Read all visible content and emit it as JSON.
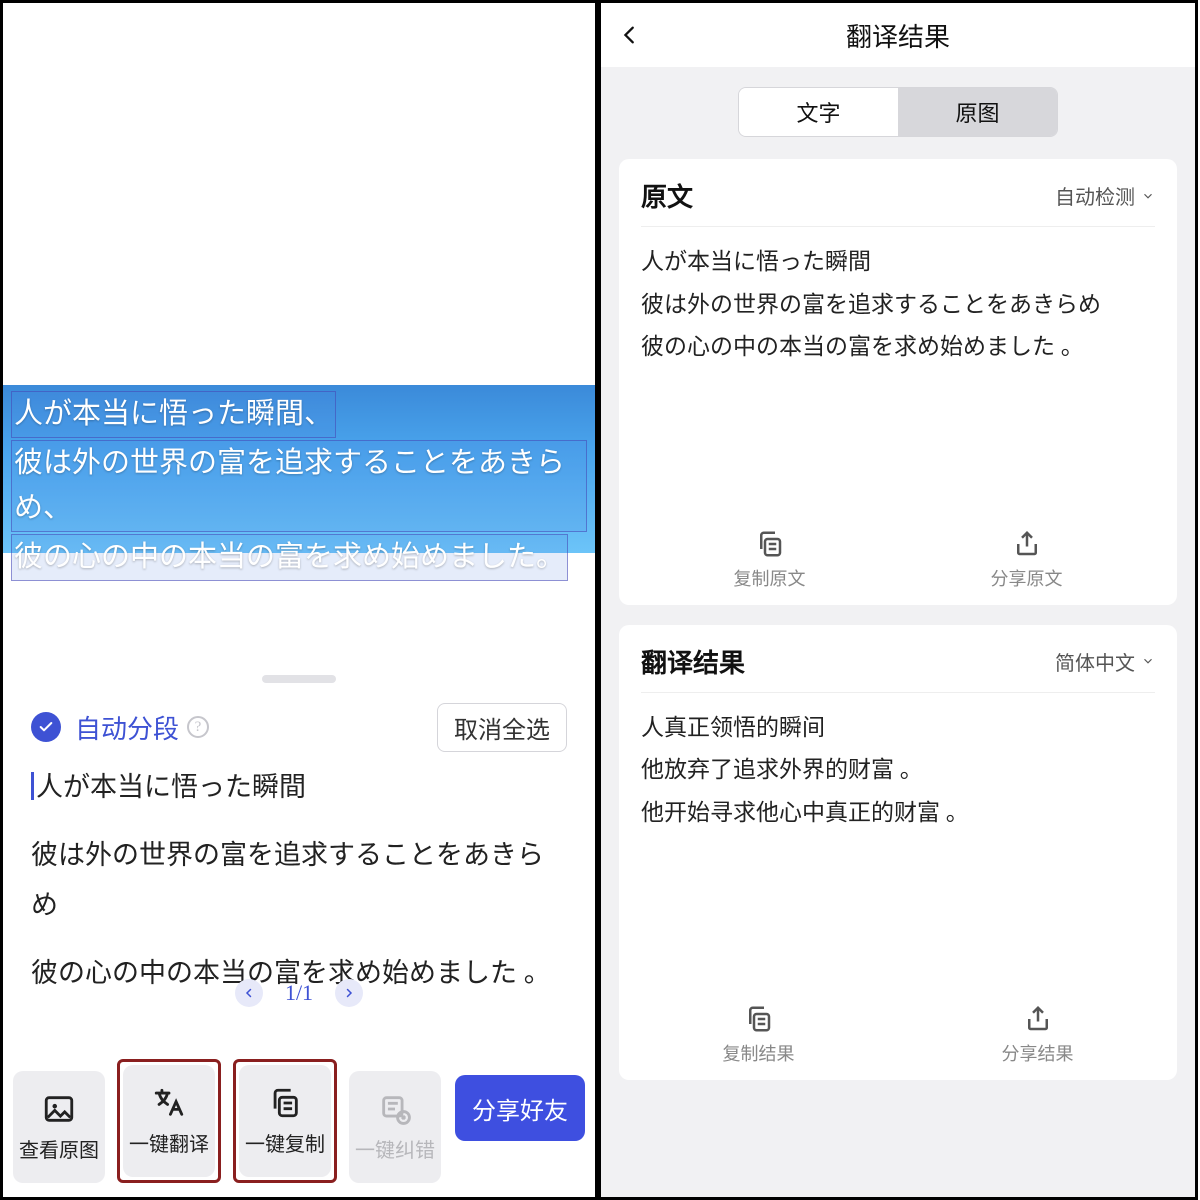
{
  "left": {
    "ocr_lines": [
      "人が本当に悟った瞬間、",
      "彼は外の世界の富を追求することをあきらめ、",
      "彼の心の中の本当の富を求め始めました。"
    ],
    "auto_segment_label": "自动分段",
    "deselect_all": "取消全选",
    "detected_lines": [
      "人が本当に悟った瞬間",
      "彼は外の世界の富を追求することをあきらめ",
      "彼の心の中の本当の富を求め始めました 。"
    ],
    "pager_text": "1/1",
    "toolbar": {
      "view_original": "查看原图",
      "translate": "一键翻译",
      "copy": "一键复制",
      "undo": "一键纠错",
      "share": "分享好友"
    }
  },
  "right": {
    "title": "翻译结果",
    "tab_text": "文字",
    "tab_image": "原图",
    "source": {
      "heading": "原文",
      "lang": "自动检测",
      "lines": [
        "人が本当に悟った瞬間",
        "彼は外の世界の富を追求することをあきらめ",
        "彼の心の中の本当の富を求め始めました 。"
      ],
      "copy_label": "复制原文",
      "share_label": "分享原文"
    },
    "result": {
      "heading": "翻译结果",
      "lang": "简体中文",
      "lines": [
        "人真正领悟的瞬间",
        "他放弃了追求外界的财富 。",
        "他开始寻求他心中真正的财富 。"
      ],
      "copy_label": "复制结果",
      "share_label": "分享结果"
    }
  }
}
